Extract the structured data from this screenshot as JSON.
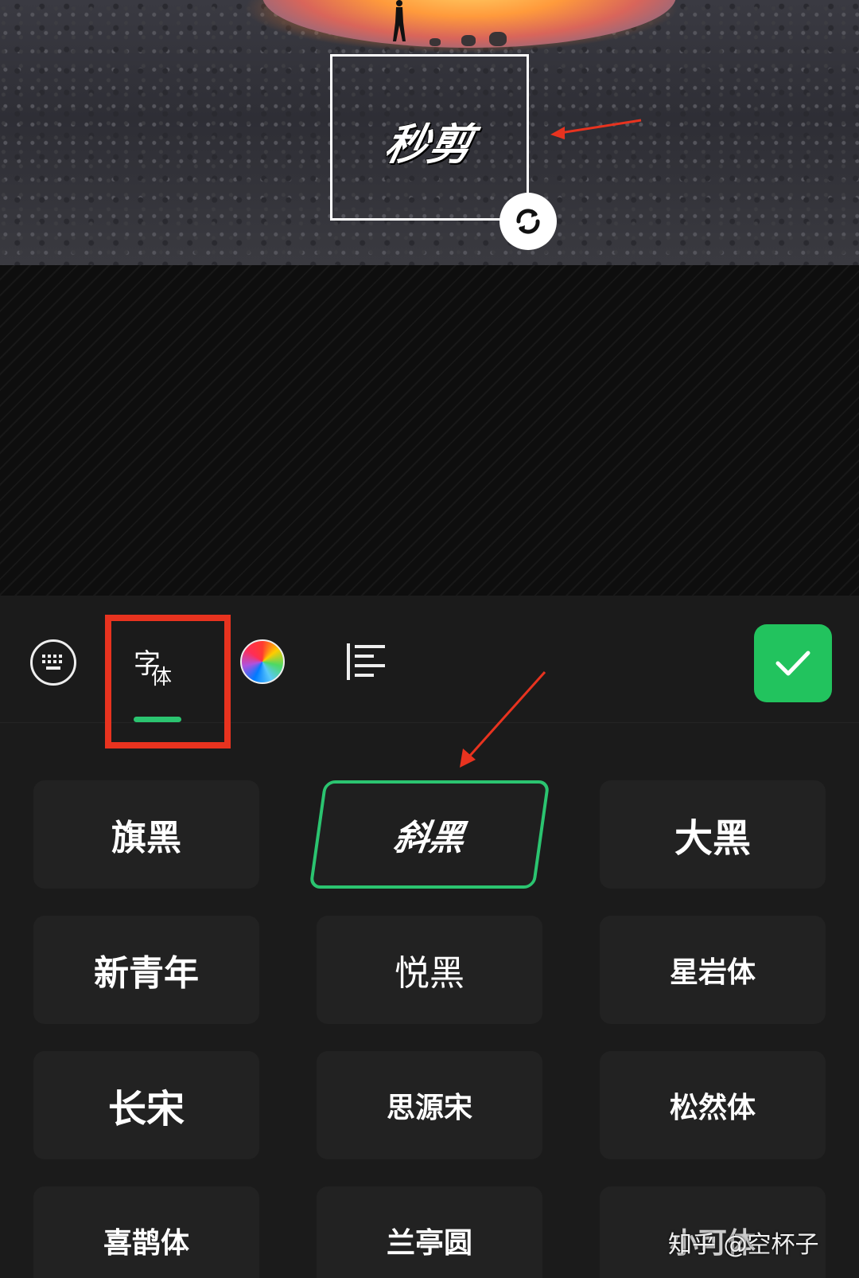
{
  "preview": {
    "text_box_text": "秒剪"
  },
  "toolbar": {
    "font_tab_char_1": "字",
    "font_tab_char_2": "体",
    "accent_color": "#2bc470",
    "confirm_color": "#22c35e",
    "highlight_color": "#e8331f",
    "icons": [
      "keyboard-icon",
      "font-icon",
      "color-wheel-icon",
      "align-left-icon",
      "checkmark-icon",
      "rotate-icon"
    ]
  },
  "fonts": {
    "selected": "斜黑",
    "items": [
      "旗黑",
      "斜黑",
      "大黑",
      "新青年",
      "悦黑",
      "星岩体",
      "长宋",
      "思源宋",
      "松然体",
      "喜鹊体",
      "兰亭圆",
      "小可体"
    ]
  },
  "watermark": "知乎 @空杯子"
}
